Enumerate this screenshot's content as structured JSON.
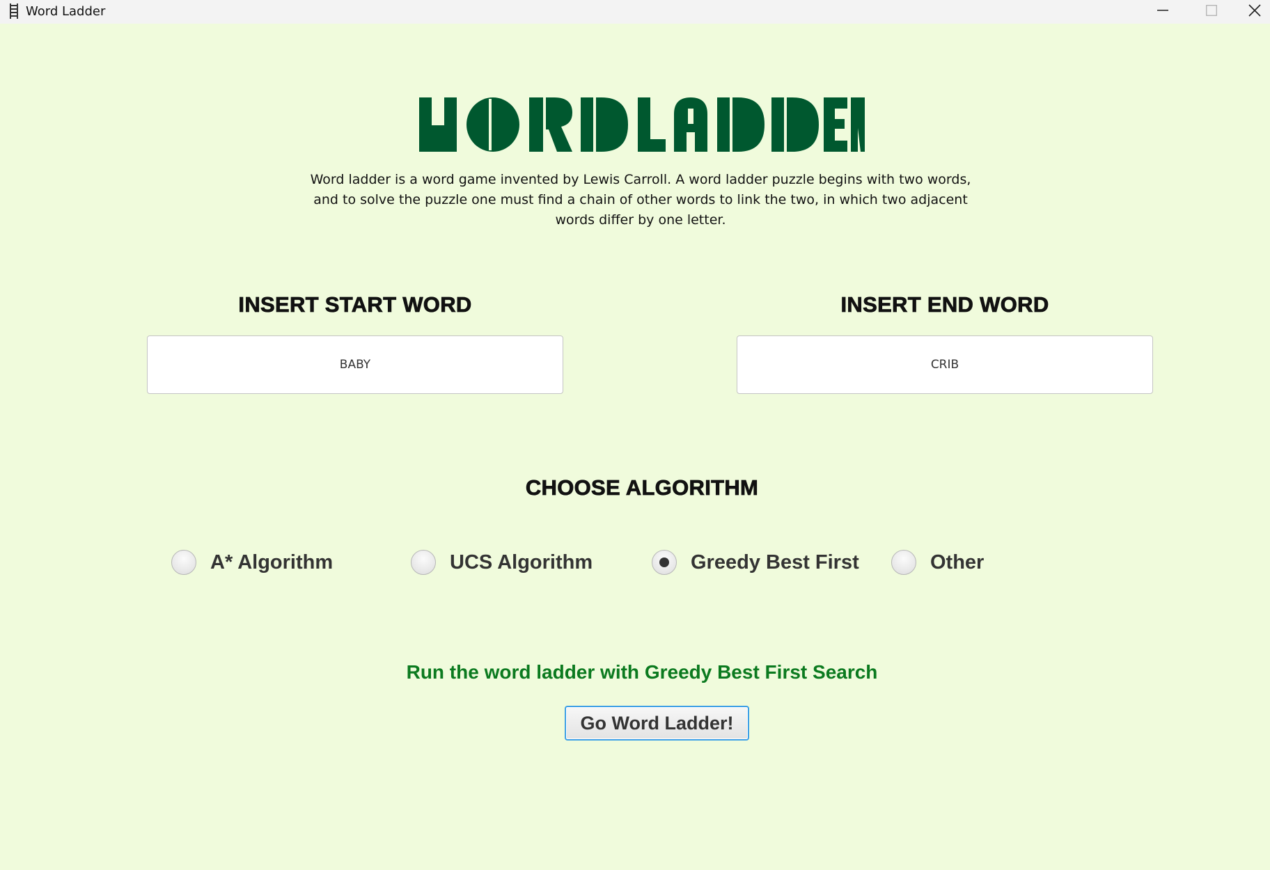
{
  "window": {
    "title": "Word Ladder",
    "controls": [
      "minimize-icon",
      "maximize-icon",
      "close-icon"
    ]
  },
  "header": {
    "logo_text": "WORDLADDER",
    "logo_color": "#00582f",
    "description": "Word ladder is a word game invented by Lewis Carroll. A word ladder puzzle begins with two words, and to solve the puzzle one must find a chain of other words to link the two, in which two adjacent words differ by one letter."
  },
  "start_word": {
    "label": "INSERT START WORD",
    "value": "BABY"
  },
  "end_word": {
    "label": "INSERT END WORD",
    "value": "CRIB"
  },
  "algorithm": {
    "label": "CHOOSE ALGORITHM",
    "options": [
      {
        "label": "A* Algorithm",
        "selected": false
      },
      {
        "label": "UCS Algorithm",
        "selected": false
      },
      {
        "label": "Greedy Best First",
        "selected": true
      },
      {
        "label": "Other",
        "selected": false
      }
    ]
  },
  "run": {
    "status_text": "Run the word ladder with Greedy Best First Search",
    "status_color": "#0b7a1f",
    "button_label": "Go Word Ladder!"
  },
  "colors": {
    "background": "#f0fbdc",
    "button_border": "#3c9fe6"
  }
}
